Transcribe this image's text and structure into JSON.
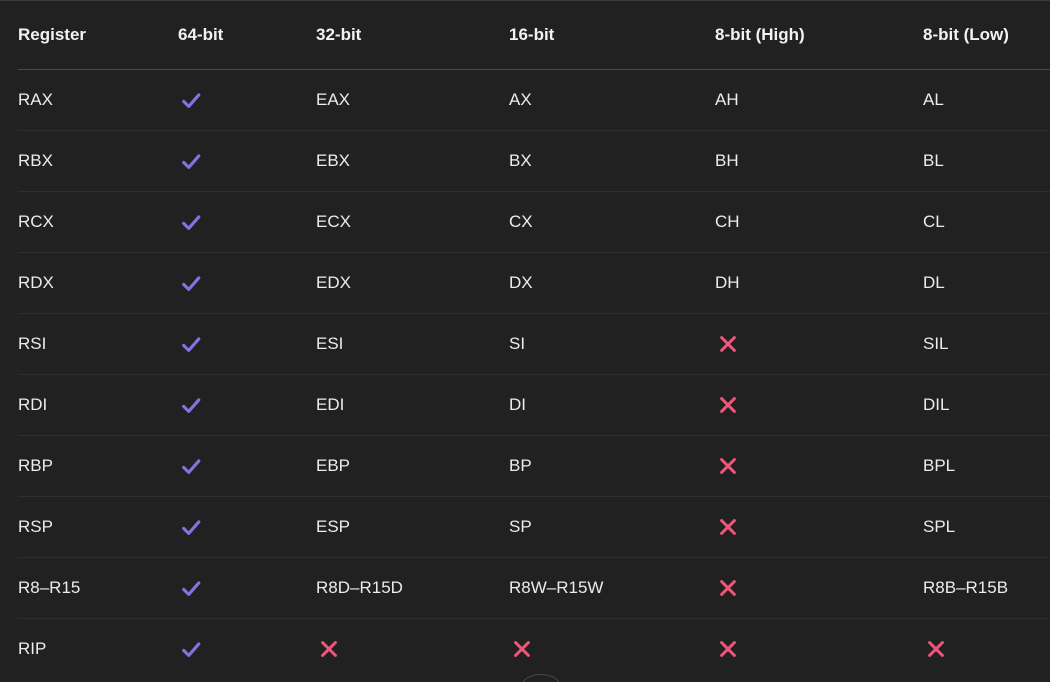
{
  "colors": {
    "background": "#212121",
    "check": "#8b6fe0",
    "cross": "#f2557a"
  },
  "headers": [
    "Register",
    "64-bit",
    "32-bit",
    "16-bit",
    "8-bit (High)",
    "8-bit (Low)"
  ],
  "rows": [
    [
      "RAX",
      "check",
      "EAX",
      "AX",
      "AH",
      "AL"
    ],
    [
      "RBX",
      "check",
      "EBX",
      "BX",
      "BH",
      "BL"
    ],
    [
      "RCX",
      "check",
      "ECX",
      "CX",
      "CH",
      "CL"
    ],
    [
      "RDX",
      "check",
      "EDX",
      "DX",
      "DH",
      "DL"
    ],
    [
      "RSI",
      "check",
      "ESI",
      "SI",
      "cross",
      "SIL"
    ],
    [
      "RDI",
      "check",
      "EDI",
      "DI",
      "cross",
      "DIL"
    ],
    [
      "RBP",
      "check",
      "EBP",
      "BP",
      "cross",
      "BPL"
    ],
    [
      "RSP",
      "check",
      "ESP",
      "SP",
      "cross",
      "SPL"
    ],
    [
      "R8–R15",
      "check",
      "R8D–R15D",
      "R8W–R15W",
      "cross",
      "R8B–R15B"
    ],
    [
      "RIP",
      "check",
      "cross",
      "cross",
      "cross",
      "cross"
    ]
  ]
}
